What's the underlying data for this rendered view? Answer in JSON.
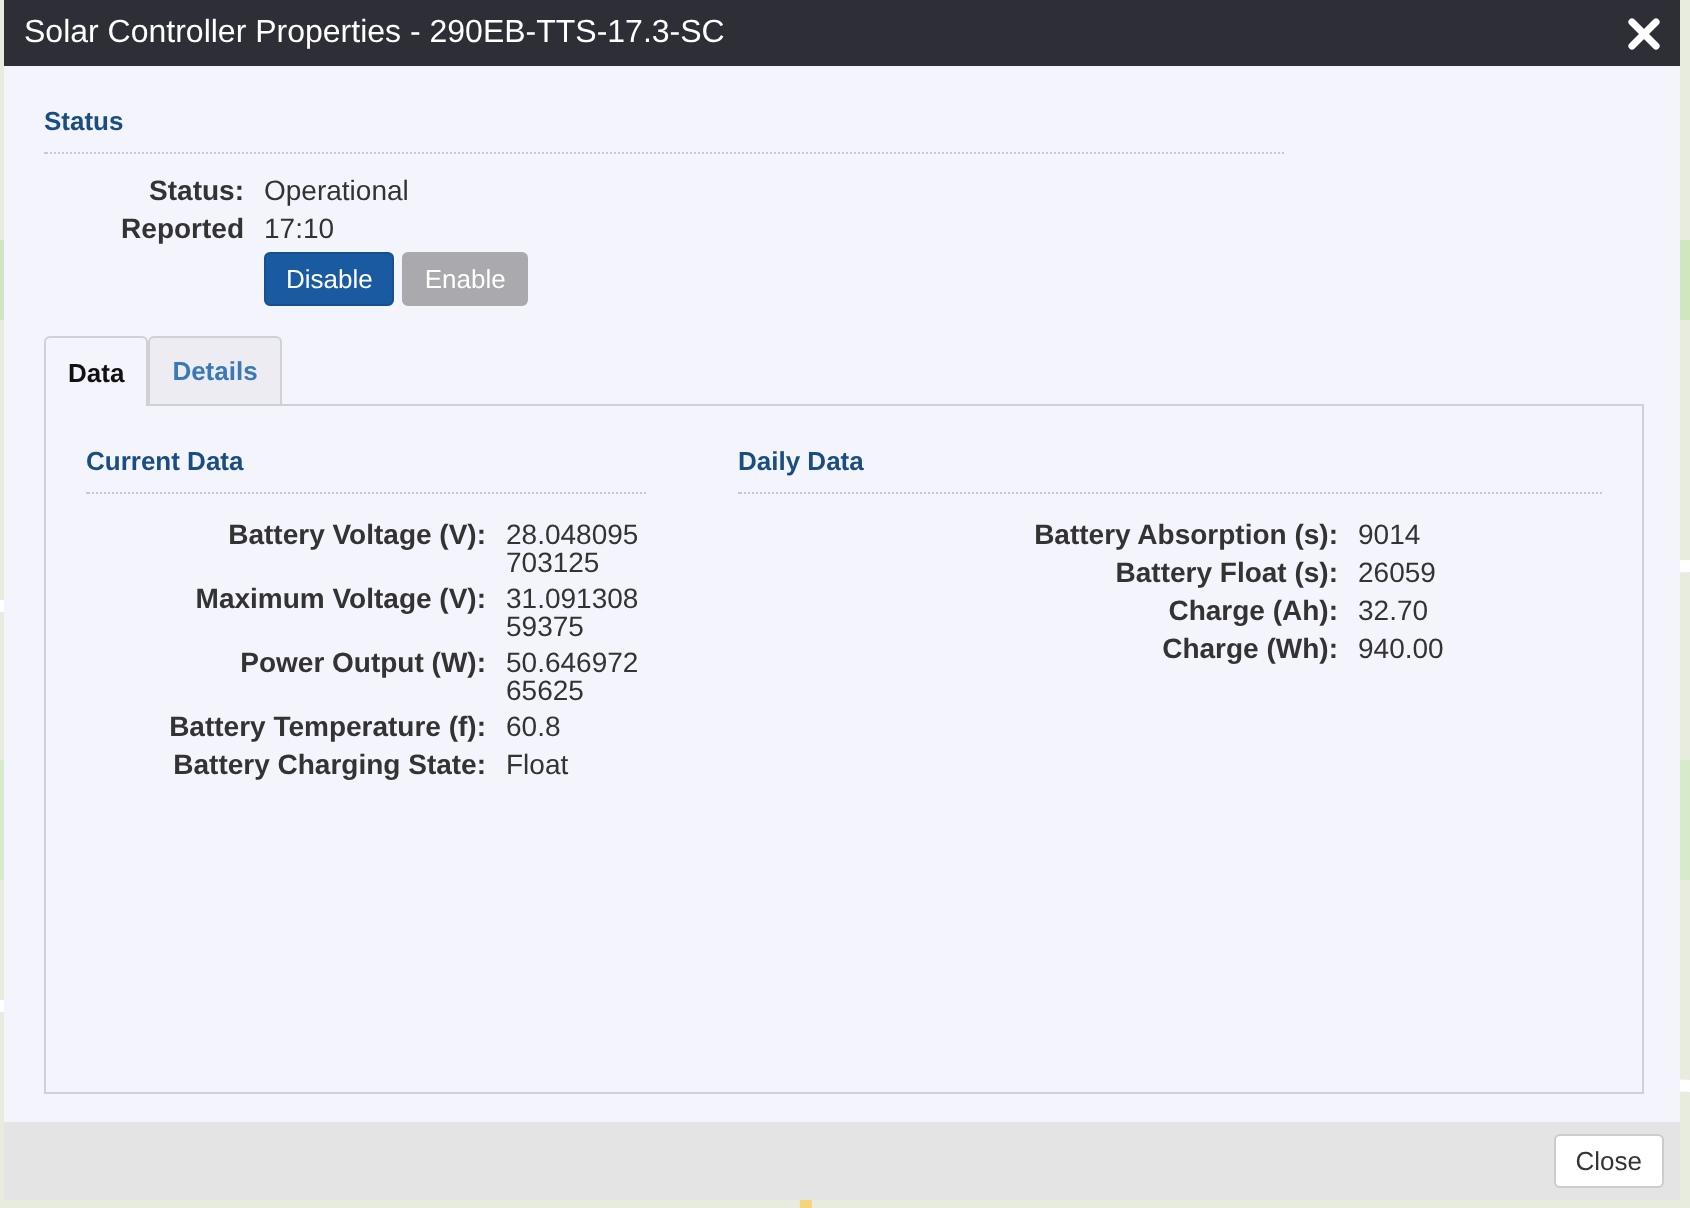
{
  "window": {
    "title": "Solar Controller Properties - 290EB-TTS-17.3-SC"
  },
  "status": {
    "heading": "Status",
    "rows": [
      {
        "label": "Status:",
        "value": "Operational"
      },
      {
        "label": "Reported",
        "value": "17:10"
      }
    ],
    "buttons": [
      {
        "label": "Disable",
        "disabled": false
      },
      {
        "label": "Enable",
        "disabled": true
      }
    ]
  },
  "tabs": [
    {
      "label": "Data",
      "selected": true
    },
    {
      "label": "Details",
      "selected": false
    }
  ],
  "sections": [
    {
      "heading": "Current Data",
      "rows": [
        {
          "label": "Battery Voltage (V):",
          "value": "28.048095703125"
        },
        {
          "label": "Maximum Voltage (V):",
          "value": "31.09130859375"
        },
        {
          "label": "Power Output (W):",
          "value": "50.64697265625"
        },
        {
          "label": "Battery Temperature (f):",
          "value": "60.8"
        },
        {
          "label": "Battery Charging State:",
          "value": "Float"
        }
      ]
    },
    {
      "heading": "Daily Data",
      "rows": [
        {
          "label": "Battery Absorption (s):",
          "value": "9014"
        },
        {
          "label": "Battery Float (s):",
          "value": "26059"
        },
        {
          "label": "Charge (Ah):",
          "value": "32.70"
        },
        {
          "label": "Charge (Wh):",
          "value": "940.00"
        }
      ]
    }
  ],
  "footer": {
    "buttons": [
      "Close"
    ]
  }
}
